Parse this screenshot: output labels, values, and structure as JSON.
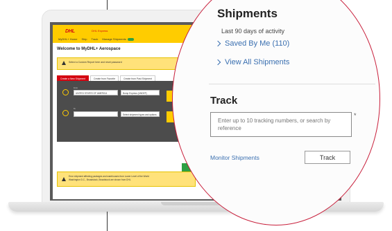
{
  "app": {
    "brand": "DHL",
    "product": "DHL Express",
    "nav": [
      "MyDHL+ Home",
      "Ship",
      "Track",
      "Manage Shipments"
    ],
    "welcome": "Welcome to MyDHL+ Aerospace",
    "warning_top": "Select a Custom Report here and reset password",
    "tabs": [
      "Create a New Shipment",
      "Create from Favorite",
      "Create from Past Shipment"
    ],
    "from_label": "From",
    "from_value": "UNITED STATES OF AMERICA",
    "from_service": "Bump Express (UNDEF)",
    "to_label": "To",
    "to_value": "Select shipment types and options",
    "warning_bottom_lines": [
      "Error shipment affecting packages and warehouses from Lower Level of the World",
      "Washington D.C., Broadstock, Broadstock are shown from DHL"
    ]
  },
  "shipments": {
    "title": "Shipments",
    "subtitle": "Last 90 days of activity",
    "links": [
      "Saved By Me (110)",
      "View All Shipments"
    ]
  },
  "track": {
    "title": "Track",
    "placeholder": "Enter up to 10 tracking numbers, or search by reference",
    "monitor_link": "Monitor Shipments",
    "button": "Track"
  },
  "colors": {
    "dhl_yellow": "#ffcc00",
    "dhl_red": "#d40511",
    "link_blue": "#3a6fb0",
    "magnifier_ring": "#c81e3a"
  }
}
